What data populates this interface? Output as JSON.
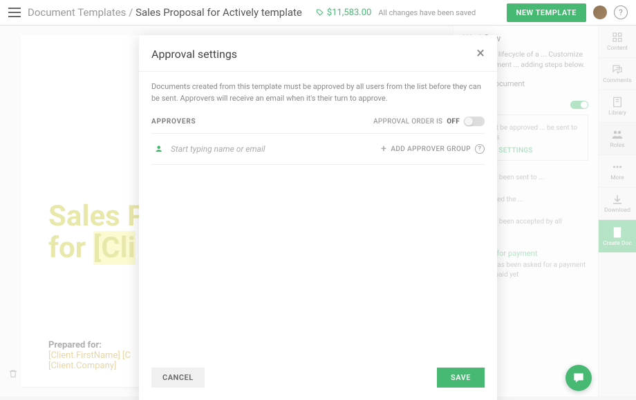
{
  "topbar": {
    "breadcrumb_root": "Document Templates",
    "breadcrumb_sep": "/",
    "breadcrumb_current": "Sales Proposal for Actively template",
    "price": "$11,583.00",
    "save_status": "All changes have been saved",
    "new_template_btn": "NEW TEMPLATE"
  },
  "document": {
    "title_line1": "Sales P",
    "title_line2_a": "for ",
    "title_line2_b": "[Cli",
    "prepared_label": "Prepared for:",
    "prepared_line1": "[Client.FirstName] [C",
    "prepared_line2": "[Client.Company]"
  },
  "workflow": {
    "title": "Workflow",
    "desc": "...fines the lifecycle of a ... Customize your document ... adding steps below.",
    "item1_title": "created document",
    "item2_title": "...nt must be approved ... be sent to recipients",
    "settings_btn": "PROVAL SETTINGS",
    "sent_desc": "...ment has been sent to ...",
    "viewed_desc": "... has viewed the ...",
    "completed_desc": "...ment has been accepted by all recipients",
    "waiting_label": "Waiting for payment",
    "waiting_desc": "Recipient has been asked for a payment but hasn't paid yet"
  },
  "rail": {
    "content": "Content",
    "comments": "Comments",
    "library": "Library",
    "roles": "Roles",
    "more": "More",
    "download": "Download",
    "create": "Create Doc"
  },
  "modal": {
    "title": "Approval settings",
    "desc": "Documents created from this template must be approved by all users from the list before they can be sent. Approvers will receive an email when it's their turn to approve.",
    "approvers_label": "APPROVERS",
    "order_label": "APPROVAL ORDER IS",
    "order_state": "OFF",
    "input_placeholder": "Start typing name or email",
    "add_group": "ADD APPROVER GROUP",
    "cancel": "CANCEL",
    "save": "SAVE"
  }
}
